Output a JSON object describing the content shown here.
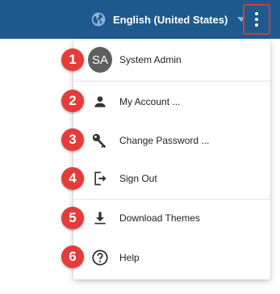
{
  "header": {
    "language_label": "English (United States)",
    "background_color": "#1e5a8e",
    "language_icon": "globe-icon",
    "more_icon": "more-vert-icon"
  },
  "menu": {
    "items": [
      {
        "label": "System Admin",
        "icon": "avatar",
        "avatar_initials": "SA"
      },
      {
        "label": "My Account ...",
        "icon": "person-icon"
      },
      {
        "label": "Change Password ...",
        "icon": "key-icon"
      },
      {
        "label": "Sign Out",
        "icon": "sign-out-icon"
      },
      {
        "label": "Download Themes",
        "icon": "download-icon"
      },
      {
        "label": "Help",
        "icon": "help-circle-icon"
      }
    ]
  },
  "annotations": {
    "badge_color": "#e63b3b",
    "highlight_color": "#d23a3a",
    "badges": [
      "1",
      "2",
      "3",
      "4",
      "5",
      "6"
    ]
  }
}
